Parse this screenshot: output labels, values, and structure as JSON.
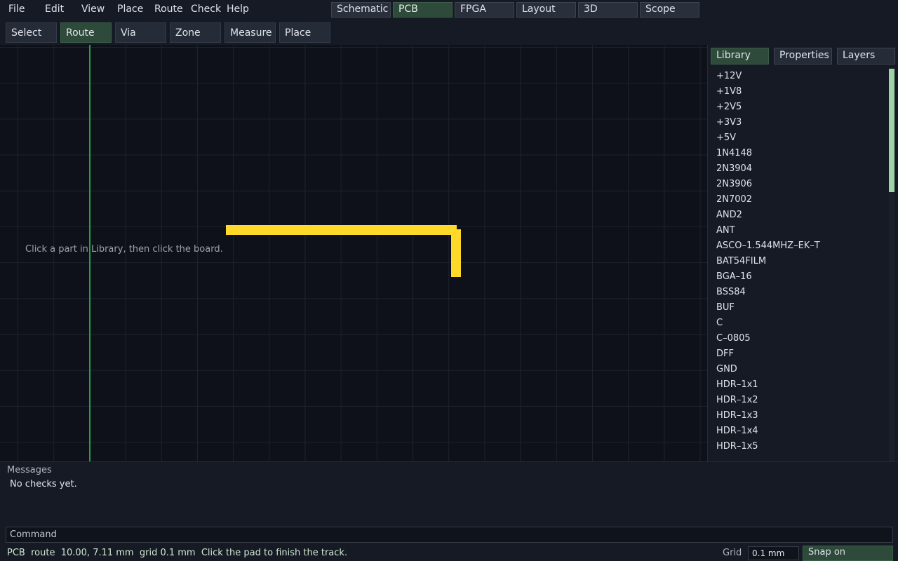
{
  "menu": {
    "items": [
      "File",
      "Edit",
      "View",
      "Place",
      "Route",
      "Check",
      "Help"
    ]
  },
  "mode_tabs": {
    "items": [
      "Schematic",
      "PCB",
      "FPGA",
      "Layout",
      "3D",
      "Scope"
    ],
    "active": "PCB"
  },
  "tools": {
    "items": [
      "Select",
      "Route",
      "Via",
      "Zone",
      "Measure",
      "Place"
    ],
    "active": "Route"
  },
  "canvas": {
    "hint": "Click a part in Library, then click the board.",
    "track_color": "#ffd92a",
    "cursor_color": "#1fa34a"
  },
  "panel": {
    "tabs": [
      "Library",
      "Properties",
      "Layers"
    ],
    "active": "Library",
    "library_items": [
      "+12V",
      "+1V8",
      "+2V5",
      "+3V3",
      "+5V",
      "1N4148",
      "2N3904",
      "2N3906",
      "2N7002",
      "AND2",
      "ANT",
      "ASCO–1.544MHZ–EK–T",
      "BAT54FILM",
      "BGA–16",
      "BSS84",
      "BUF",
      "C",
      "C–0805",
      "DFF",
      "GND",
      "HDR–1x1",
      "HDR–1x2",
      "HDR–1x3",
      "HDR–1x4",
      "HDR–1x5"
    ]
  },
  "messages": {
    "title": "Messages",
    "text": "No checks yet."
  },
  "command": {
    "placeholder": "Command"
  },
  "status": {
    "text": "PCB  route  10.00, 7.11 mm  grid 0.1 mm  Click the pad to finish the track.",
    "grid_label": "Grid",
    "grid_value": "0.1 mm",
    "snap_label": "Snap on"
  },
  "colors": {
    "accent": "#2e4a3a",
    "background": "#0e1119"
  }
}
